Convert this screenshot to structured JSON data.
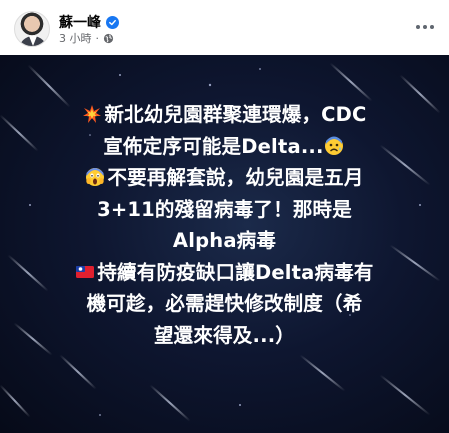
{
  "post": {
    "author": "蘇一峰",
    "timestamp": "3 小時",
    "separator": "·"
  },
  "image_text": {
    "lines": [
      "新北幼兒園群聚連環爆，CDC",
      "宣佈定序可能是Delta...",
      "不要再解套說，幼兒園是五月",
      "3+11的殘留病毒了！那時是",
      "Alpha病毒",
      "持續有防疫缺口讓Delta病毒有",
      "機可趁，必需趕快修改制度（希",
      "望還來得及...）"
    ]
  },
  "icons": {
    "verified": "verified-badge-icon",
    "privacy": "globe-icon",
    "more": "more-options-icon",
    "emoji_1": "collision-icon",
    "emoji_2": "anxious-face-icon",
    "emoji_3": "screaming-face-icon",
    "emoji_4": "taiwan-flag-icon"
  },
  "colors": {
    "verified": "#1877f2",
    "meta_text": "#65676b",
    "image_bg": "#0e1630",
    "image_text": "#ffffff"
  }
}
